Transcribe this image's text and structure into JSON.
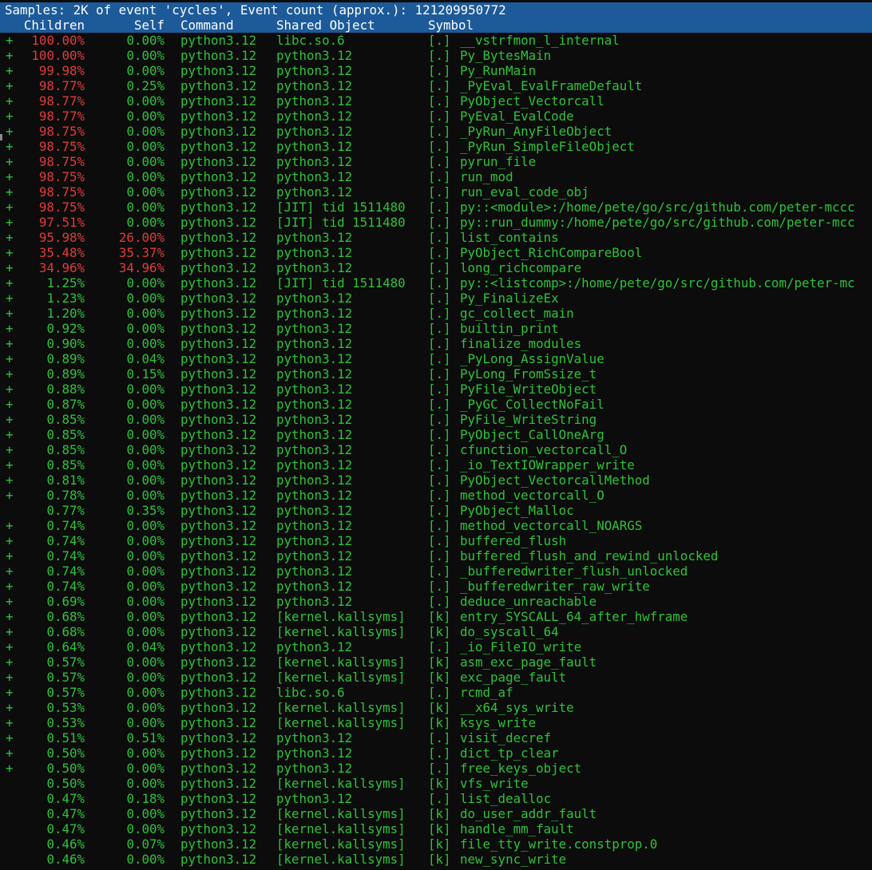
{
  "title": "Samples: 2K of event 'cycles', Event count (approx.): 121209950772",
  "columns": {
    "children": "Children",
    "self": "Self",
    "command": "Command",
    "shared_object": "Shared Object",
    "symbol": "Symbol"
  },
  "colors": {
    "header_bg": "#1c5a9a",
    "hot": "#e23a3a",
    "normal": "#2ec23a",
    "background": "#0c0c0c"
  },
  "rows": [
    {
      "plus": "+",
      "children": "100.00%",
      "self": "0.00%",
      "command": "python3.12",
      "object": "libc.so.6",
      "type": "[.]",
      "symbol": "__vstrfmon_l_internal",
      "hot_children": true,
      "hot_self": false
    },
    {
      "plus": "+",
      "children": "100.00%",
      "self": "0.00%",
      "command": "python3.12",
      "object": "python3.12",
      "type": "[.]",
      "symbol": "Py_BytesMain",
      "hot_children": true,
      "hot_self": false
    },
    {
      "plus": "+",
      "children": "99.98%",
      "self": "0.00%",
      "command": "python3.12",
      "object": "python3.12",
      "type": "[.]",
      "symbol": "Py_RunMain",
      "hot_children": true,
      "hot_self": false
    },
    {
      "plus": "+",
      "children": "98.77%",
      "self": "0.25%",
      "command": "python3.12",
      "object": "python3.12",
      "type": "[.]",
      "symbol": "_PyEval_EvalFrameDefault",
      "hot_children": true,
      "hot_self": false
    },
    {
      "plus": "+",
      "children": "98.77%",
      "self": "0.00%",
      "command": "python3.12",
      "object": "python3.12",
      "type": "[.]",
      "symbol": "PyObject_Vectorcall",
      "hot_children": true,
      "hot_self": false
    },
    {
      "plus": "+",
      "children": "98.77%",
      "self": "0.00%",
      "command": "python3.12",
      "object": "python3.12",
      "type": "[.]",
      "symbol": "PyEval_EvalCode",
      "hot_children": true,
      "hot_self": false
    },
    {
      "plus": "+",
      "children": "98.75%",
      "self": "0.00%",
      "command": "python3.12",
      "object": "python3.12",
      "type": "[.]",
      "symbol": "_PyRun_AnyFileObject",
      "hot_children": true,
      "hot_self": false
    },
    {
      "plus": "+",
      "children": "98.75%",
      "self": "0.00%",
      "command": "python3.12",
      "object": "python3.12",
      "type": "[.]",
      "symbol": "_PyRun_SimpleFileObject",
      "hot_children": true,
      "hot_self": false
    },
    {
      "plus": "+",
      "children": "98.75%",
      "self": "0.00%",
      "command": "python3.12",
      "object": "python3.12",
      "type": "[.]",
      "symbol": "pyrun_file",
      "hot_children": true,
      "hot_self": false
    },
    {
      "plus": "+",
      "children": "98.75%",
      "self": "0.00%",
      "command": "python3.12",
      "object": "python3.12",
      "type": "[.]",
      "symbol": "run_mod",
      "hot_children": true,
      "hot_self": false
    },
    {
      "plus": "+",
      "children": "98.75%",
      "self": "0.00%",
      "command": "python3.12",
      "object": "python3.12",
      "type": "[.]",
      "symbol": "run_eval_code_obj",
      "hot_children": true,
      "hot_self": false
    },
    {
      "plus": "+",
      "children": "98.75%",
      "self": "0.00%",
      "command": "python3.12",
      "object": "[JIT] tid 1511480",
      "type": "[.]",
      "symbol": "py::<module>:/home/pete/go/src/github.com/peter-mccc",
      "hot_children": true,
      "hot_self": false
    },
    {
      "plus": "+",
      "children": "97.51%",
      "self": "0.00%",
      "command": "python3.12",
      "object": "[JIT] tid 1511480",
      "type": "[.]",
      "symbol": "py::run_dummy:/home/pete/go/src/github.com/peter-mcc",
      "hot_children": true,
      "hot_self": false
    },
    {
      "plus": "+",
      "children": "95.98%",
      "self": "26.00%",
      "command": "python3.12",
      "object": "python3.12",
      "type": "[.]",
      "symbol": "list_contains",
      "hot_children": true,
      "hot_self": true
    },
    {
      "plus": "+",
      "children": "35.48%",
      "self": "35.37%",
      "command": "python3.12",
      "object": "python3.12",
      "type": "[.]",
      "symbol": "PyObject_RichCompareBool",
      "hot_children": true,
      "hot_self": true
    },
    {
      "plus": "+",
      "children": "34.96%",
      "self": "34.96%",
      "command": "python3.12",
      "object": "python3.12",
      "type": "[.]",
      "symbol": "long_richcompare",
      "hot_children": true,
      "hot_self": true
    },
    {
      "plus": "+",
      "children": "1.25%",
      "self": "0.00%",
      "command": "python3.12",
      "object": "[JIT] tid 1511480",
      "type": "[.]",
      "symbol": "py::<listcomp>:/home/pete/go/src/github.com/peter-mc",
      "hot_children": false,
      "hot_self": false
    },
    {
      "plus": "+",
      "children": "1.23%",
      "self": "0.00%",
      "command": "python3.12",
      "object": "python3.12",
      "type": "[.]",
      "symbol": "Py_FinalizeEx",
      "hot_children": false,
      "hot_self": false
    },
    {
      "plus": "+",
      "children": "1.20%",
      "self": "0.00%",
      "command": "python3.12",
      "object": "python3.12",
      "type": "[.]",
      "symbol": "gc_collect_main",
      "hot_children": false,
      "hot_self": false
    },
    {
      "plus": "+",
      "children": "0.92%",
      "self": "0.00%",
      "command": "python3.12",
      "object": "python3.12",
      "type": "[.]",
      "symbol": "builtin_print",
      "hot_children": false,
      "hot_self": false
    },
    {
      "plus": "+",
      "children": "0.90%",
      "self": "0.00%",
      "command": "python3.12",
      "object": "python3.12",
      "type": "[.]",
      "symbol": "finalize_modules",
      "hot_children": false,
      "hot_self": false
    },
    {
      "plus": "+",
      "children": "0.89%",
      "self": "0.04%",
      "command": "python3.12",
      "object": "python3.12",
      "type": "[.]",
      "symbol": "_PyLong_AssignValue",
      "hot_children": false,
      "hot_self": false
    },
    {
      "plus": "+",
      "children": "0.89%",
      "self": "0.15%",
      "command": "python3.12",
      "object": "python3.12",
      "type": "[.]",
      "symbol": "PyLong_FromSsize_t",
      "hot_children": false,
      "hot_self": false
    },
    {
      "plus": "+",
      "children": "0.88%",
      "self": "0.00%",
      "command": "python3.12",
      "object": "python3.12",
      "type": "[.]",
      "symbol": "PyFile_WriteObject",
      "hot_children": false,
      "hot_self": false
    },
    {
      "plus": "+",
      "children": "0.87%",
      "self": "0.00%",
      "command": "python3.12",
      "object": "python3.12",
      "type": "[.]",
      "symbol": "_PyGC_CollectNoFail",
      "hot_children": false,
      "hot_self": false
    },
    {
      "plus": "+",
      "children": "0.85%",
      "self": "0.00%",
      "command": "python3.12",
      "object": "python3.12",
      "type": "[.]",
      "symbol": "PyFile_WriteString",
      "hot_children": false,
      "hot_self": false
    },
    {
      "plus": "+",
      "children": "0.85%",
      "self": "0.00%",
      "command": "python3.12",
      "object": "python3.12",
      "type": "[.]",
      "symbol": "PyObject_CallOneArg",
      "hot_children": false,
      "hot_self": false
    },
    {
      "plus": "+",
      "children": "0.85%",
      "self": "0.00%",
      "command": "python3.12",
      "object": "python3.12",
      "type": "[.]",
      "symbol": "cfunction_vectorcall_O",
      "hot_children": false,
      "hot_self": false
    },
    {
      "plus": "+",
      "children": "0.85%",
      "self": "0.00%",
      "command": "python3.12",
      "object": "python3.12",
      "type": "[.]",
      "symbol": "_io_TextIOWrapper_write",
      "hot_children": false,
      "hot_self": false
    },
    {
      "plus": "+",
      "children": "0.81%",
      "self": "0.00%",
      "command": "python3.12",
      "object": "python3.12",
      "type": "[.]",
      "symbol": "PyObject_VectorcallMethod",
      "hot_children": false,
      "hot_self": false
    },
    {
      "plus": "+",
      "children": "0.78%",
      "self": "0.00%",
      "command": "python3.12",
      "object": "python3.12",
      "type": "[.]",
      "symbol": "method_vectorcall_O",
      "hot_children": false,
      "hot_self": false
    },
    {
      "plus": "",
      "children": "0.77%",
      "self": "0.35%",
      "command": "python3.12",
      "object": "python3.12",
      "type": "[.]",
      "symbol": "PyObject_Malloc",
      "hot_children": false,
      "hot_self": false
    },
    {
      "plus": "+",
      "children": "0.74%",
      "self": "0.00%",
      "command": "python3.12",
      "object": "python3.12",
      "type": "[.]",
      "symbol": "method_vectorcall_NOARGS",
      "hot_children": false,
      "hot_self": false
    },
    {
      "plus": "+",
      "children": "0.74%",
      "self": "0.00%",
      "command": "python3.12",
      "object": "python3.12",
      "type": "[.]",
      "symbol": "buffered_flush",
      "hot_children": false,
      "hot_self": false
    },
    {
      "plus": "+",
      "children": "0.74%",
      "self": "0.00%",
      "command": "python3.12",
      "object": "python3.12",
      "type": "[.]",
      "symbol": "buffered_flush_and_rewind_unlocked",
      "hot_children": false,
      "hot_self": false
    },
    {
      "plus": "+",
      "children": "0.74%",
      "self": "0.00%",
      "command": "python3.12",
      "object": "python3.12",
      "type": "[.]",
      "symbol": "_bufferedwriter_flush_unlocked",
      "hot_children": false,
      "hot_self": false
    },
    {
      "plus": "+",
      "children": "0.74%",
      "self": "0.00%",
      "command": "python3.12",
      "object": "python3.12",
      "type": "[.]",
      "symbol": "_bufferedwriter_raw_write",
      "hot_children": false,
      "hot_self": false
    },
    {
      "plus": "+",
      "children": "0.69%",
      "self": "0.00%",
      "command": "python3.12",
      "object": "python3.12",
      "type": "[.]",
      "symbol": "deduce_unreachable",
      "hot_children": false,
      "hot_self": false
    },
    {
      "plus": "+",
      "children": "0.68%",
      "self": "0.00%",
      "command": "python3.12",
      "object": "[kernel.kallsyms]",
      "type": "[k]",
      "symbol": "entry_SYSCALL_64_after_hwframe",
      "hot_children": false,
      "hot_self": false
    },
    {
      "plus": "+",
      "children": "0.68%",
      "self": "0.00%",
      "command": "python3.12",
      "object": "[kernel.kallsyms]",
      "type": "[k]",
      "symbol": "do_syscall_64",
      "hot_children": false,
      "hot_self": false
    },
    {
      "plus": "+",
      "children": "0.64%",
      "self": "0.04%",
      "command": "python3.12",
      "object": "python3.12",
      "type": "[.]",
      "symbol": "_io_FileIO_write",
      "hot_children": false,
      "hot_self": false
    },
    {
      "plus": "+",
      "children": "0.57%",
      "self": "0.00%",
      "command": "python3.12",
      "object": "[kernel.kallsyms]",
      "type": "[k]",
      "symbol": "asm_exc_page_fault",
      "hot_children": false,
      "hot_self": false
    },
    {
      "plus": "+",
      "children": "0.57%",
      "self": "0.00%",
      "command": "python3.12",
      "object": "[kernel.kallsyms]",
      "type": "[k]",
      "symbol": "exc_page_fault",
      "hot_children": false,
      "hot_self": false
    },
    {
      "plus": "+",
      "children": "0.57%",
      "self": "0.00%",
      "command": "python3.12",
      "object": "libc.so.6",
      "type": "[.]",
      "symbol": "rcmd_af",
      "hot_children": false,
      "hot_self": false
    },
    {
      "plus": "+",
      "children": "0.53%",
      "self": "0.00%",
      "command": "python3.12",
      "object": "[kernel.kallsyms]",
      "type": "[k]",
      "symbol": "__x64_sys_write",
      "hot_children": false,
      "hot_self": false
    },
    {
      "plus": "+",
      "children": "0.53%",
      "self": "0.00%",
      "command": "python3.12",
      "object": "[kernel.kallsyms]",
      "type": "[k]",
      "symbol": "ksys_write",
      "hot_children": false,
      "hot_self": false
    },
    {
      "plus": "+",
      "children": "0.51%",
      "self": "0.51%",
      "command": "python3.12",
      "object": "python3.12",
      "type": "[.]",
      "symbol": "visit_decref",
      "hot_children": false,
      "hot_self": false
    },
    {
      "plus": "+",
      "children": "0.50%",
      "self": "0.00%",
      "command": "python3.12",
      "object": "python3.12",
      "type": "[.]",
      "symbol": "dict_tp_clear",
      "hot_children": false,
      "hot_self": false
    },
    {
      "plus": "+",
      "children": "0.50%",
      "self": "0.00%",
      "command": "python3.12",
      "object": "python3.12",
      "type": "[.]",
      "symbol": "free_keys_object",
      "hot_children": false,
      "hot_self": false
    },
    {
      "plus": "",
      "children": "0.50%",
      "self": "0.00%",
      "command": "python3.12",
      "object": "[kernel.kallsyms]",
      "type": "[k]",
      "symbol": "vfs_write",
      "hot_children": false,
      "hot_self": false
    },
    {
      "plus": "",
      "children": "0.47%",
      "self": "0.18%",
      "command": "python3.12",
      "object": "python3.12",
      "type": "[.]",
      "symbol": "list_dealloc",
      "hot_children": false,
      "hot_self": false
    },
    {
      "plus": "",
      "children": "0.47%",
      "self": "0.00%",
      "command": "python3.12",
      "object": "[kernel.kallsyms]",
      "type": "[k]",
      "symbol": "do_user_addr_fault",
      "hot_children": false,
      "hot_self": false
    },
    {
      "plus": "",
      "children": "0.47%",
      "self": "0.00%",
      "command": "python3.12",
      "object": "[kernel.kallsyms]",
      "type": "[k]",
      "symbol": "handle_mm_fault",
      "hot_children": false,
      "hot_self": false
    },
    {
      "plus": "",
      "children": "0.46%",
      "self": "0.07%",
      "command": "python3.12",
      "object": "[kernel.kallsyms]",
      "type": "[k]",
      "symbol": "file_tty_write.constprop.0",
      "hot_children": false,
      "hot_self": false
    },
    {
      "plus": "",
      "children": "0.46%",
      "self": "0.00%",
      "command": "python3.12",
      "object": "[kernel.kallsyms]",
      "type": "[k]",
      "symbol": "new_sync_write",
      "hot_children": false,
      "hot_self": false
    }
  ]
}
